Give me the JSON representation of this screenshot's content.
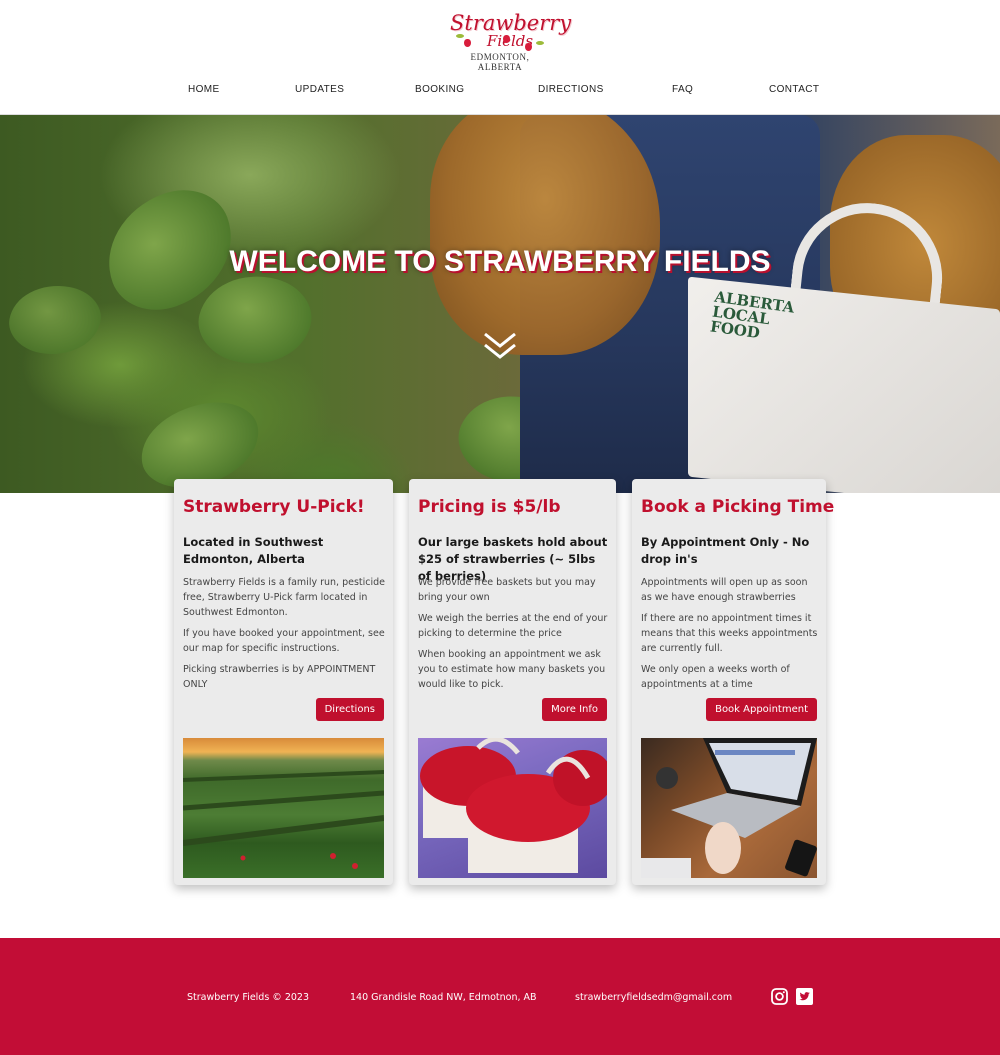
{
  "logo": {
    "line1": "Strawberry",
    "line2": "Fields",
    "location": "EDMONTON, ALBERTA"
  },
  "nav": {
    "items": [
      {
        "label": "HOME"
      },
      {
        "label": "UPDATES"
      },
      {
        "label": "BOOKING"
      },
      {
        "label": "DIRECTIONS"
      },
      {
        "label": "FAQ"
      },
      {
        "label": "CONTACT"
      }
    ]
  },
  "hero": {
    "title": "WELCOME TO STRAWBERRY FIELDS",
    "basket_text": [
      "ALBERTA",
      "LOCAL",
      "FOOD"
    ]
  },
  "cards": [
    {
      "title": "Strawberry U-Pick!",
      "subtitle": "Located in Southwest Edmonton, Alberta",
      "paragraphs": [
        "Strawberry Fields is a family run, pesticide free, Strawberry U-Pick farm located in Southwest Edmonton.",
        "If you have booked your appointment, see our map for specific instructions.",
        "Picking strawberries is by APPOINTMENT ONLY"
      ],
      "button": "Directions",
      "image": "strawberry-field-sunset"
    },
    {
      "title": "Pricing is $5/lb",
      "subtitle": "Our large baskets hold about $25 of strawberries (~ 5lbs of berries)",
      "paragraphs": [
        "We provide free baskets but you may bring your own",
        "We weigh the berries at the end of your picking to determine the price",
        "When booking an appointment we ask you to estimate how many baskets you would like to pick."
      ],
      "button": "More Info",
      "image": "baskets-of-strawberries"
    },
    {
      "title": "Book a Picking Time",
      "subtitle": "By Appointment Only - No drop in's",
      "paragraphs": [
        "Appointments will open up as soon as we have enough strawberries",
        "If there are no appointment times it means that this weeks appointments are currently full.",
        "We only open a weeks worth of appointments at a time"
      ],
      "button": "Book Appointment",
      "image": "laptop-on-desk"
    }
  ],
  "footer": {
    "copyright": "Strawberry Fields © 2023",
    "address": "140 Grandisle Road NW, Edmotnon, AB",
    "email": "strawberryfieldsedm@gmail.com",
    "icons": [
      "instagram-icon",
      "twitter-icon"
    ]
  },
  "colors": {
    "brand_red": "#c0102e",
    "footer_red": "#c20d36",
    "card_bg": "#ebebeb"
  }
}
